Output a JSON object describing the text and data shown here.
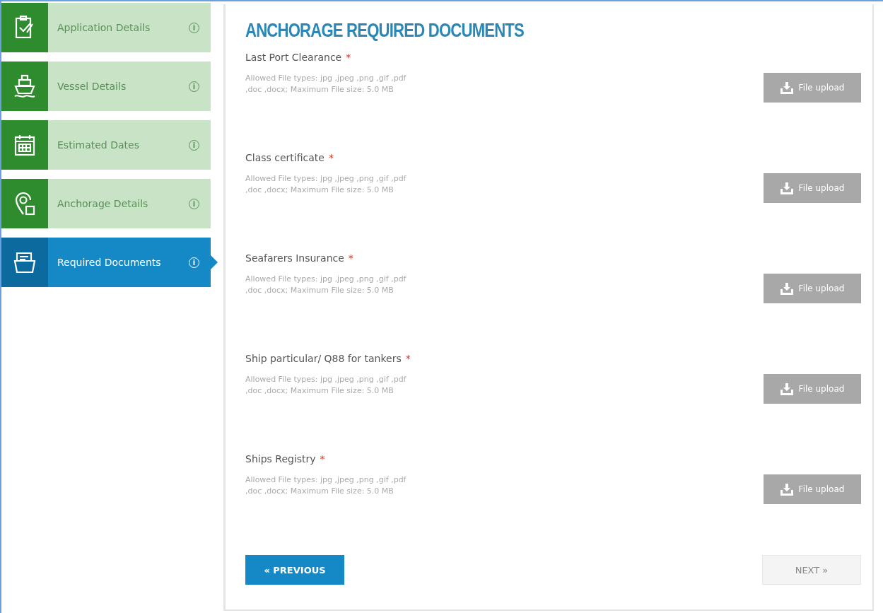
{
  "steps": [
    {
      "kind": "checklist",
      "label": "Application Details",
      "info": "i",
      "selected": false
    },
    {
      "kind": "ship",
      "label": "Vessel Details",
      "info": "i",
      "selected": false
    },
    {
      "kind": "calendar",
      "label": "Estimated Dates",
      "info": "i",
      "selected": false
    },
    {
      "kind": "location",
      "label": "Anchorage Details",
      "info": "i",
      "selected": false
    },
    {
      "kind": "folder",
      "label": "Required Documents",
      "info": "i",
      "selected": true
    }
  ],
  "title": "ANCHORAGE REQUIRED DOCUMENTS",
  "documents": [
    {
      "label": "Last Port Clearance",
      "mark": "*",
      "hint": "Allowed File types: jpg ,jpeg ,png ,gif ,pdf ,doc ,docx; Maximum File size: 5.0 MB",
      "button": "File upload"
    },
    {
      "label": "Class certificate",
      "mark": "*",
      "hint": "Allowed File types: jpg ,jpeg ,png ,gif ,pdf ,doc ,docx; Maximum File size: 5.0 MB",
      "button": "File upload"
    },
    {
      "label": "Seafarers Insurance",
      "mark": "*",
      "hint": "Allowed File types: jpg ,jpeg ,png ,gif ,pdf ,doc ,docx; Maximum File size: 5.0 MB",
      "button": "File upload"
    },
    {
      "label": "Ship particular/ Q88 for tankers",
      "mark": "*",
      "hint": "Allowed File types: jpg ,jpeg ,png ,gif ,pdf ,doc ,docx; Maximum File size: 5.0 MB",
      "button": "File upload"
    },
    {
      "label": "Ships Registry",
      "mark": "*",
      "hint": "Allowed File types: jpg ,jpeg ,png ,gif ,pdf ,doc ,docx; Maximum File size: 5.0 MB",
      "button": "File upload"
    }
  ],
  "previous": {
    "label": "« PREVIOUS",
    "disabled": false
  },
  "next": {
    "label": "NEXT »",
    "disabled": true
  }
}
